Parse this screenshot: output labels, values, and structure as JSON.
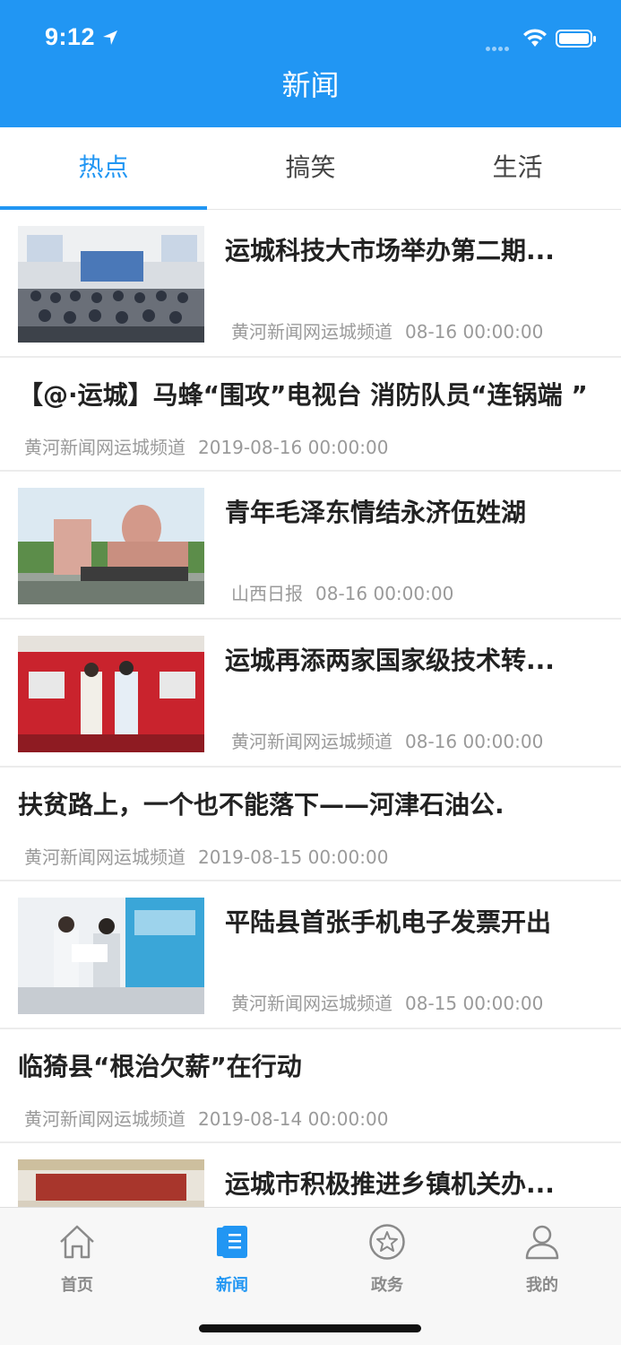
{
  "status_bar": {
    "time": "9:12"
  },
  "header": {
    "title": "新闻"
  },
  "tabs": [
    {
      "label": "热点",
      "active": true
    },
    {
      "label": "搞笑",
      "active": false
    },
    {
      "label": "生活",
      "active": false
    }
  ],
  "articles": [
    {
      "title": "运城科技大市场举办第二期...",
      "source": "黄河新闻网运城频道",
      "date": "08-16 00:00:00",
      "has_image": true
    },
    {
      "title": "【@·运城】马蜂“围攻”电视台 消防队员“连锅端 ”",
      "source": "黄河新闻网运城频道",
      "date": "2019-08-16 00:00:00",
      "has_image": false
    },
    {
      "title": "青年毛泽东情结永济伍姓湖",
      "source": "山西日报",
      "date": "08-16 00:00:00",
      "has_image": true
    },
    {
      "title": "运城再添两家国家级技术转...",
      "source": "黄河新闻网运城频道",
      "date": "08-16 00:00:00",
      "has_image": true
    },
    {
      "title": "扶贫路上，一个也不能落下——河津石油公.",
      "source": "黄河新闻网运城频道",
      "date": "2019-08-15 00:00:00",
      "has_image": false
    },
    {
      "title": "平陆县首张手机电子发票开出",
      "source": "黄河新闻网运城频道",
      "date": "08-15 00:00:00",
      "has_image": true
    },
    {
      "title": "临猗县“根治欠薪”在行动",
      "source": "黄河新闻网运城频道",
      "date": "2019-08-14 00:00:00",
      "has_image": false
    },
    {
      "title": "运城市积极推进乡镇机关办...",
      "source": "",
      "date": "",
      "has_image": true
    }
  ],
  "bottom_tabs": [
    {
      "label": "首页",
      "icon": "home-icon",
      "active": false
    },
    {
      "label": "新闻",
      "icon": "news-icon",
      "active": true
    },
    {
      "label": "政务",
      "icon": "star-icon",
      "active": false
    },
    {
      "label": "我的",
      "icon": "user-icon",
      "active": false
    }
  ],
  "colors": {
    "accent": "#2196f3",
    "meta_text": "#9a9a9a",
    "inactive_tab": "#8a8a8a"
  }
}
